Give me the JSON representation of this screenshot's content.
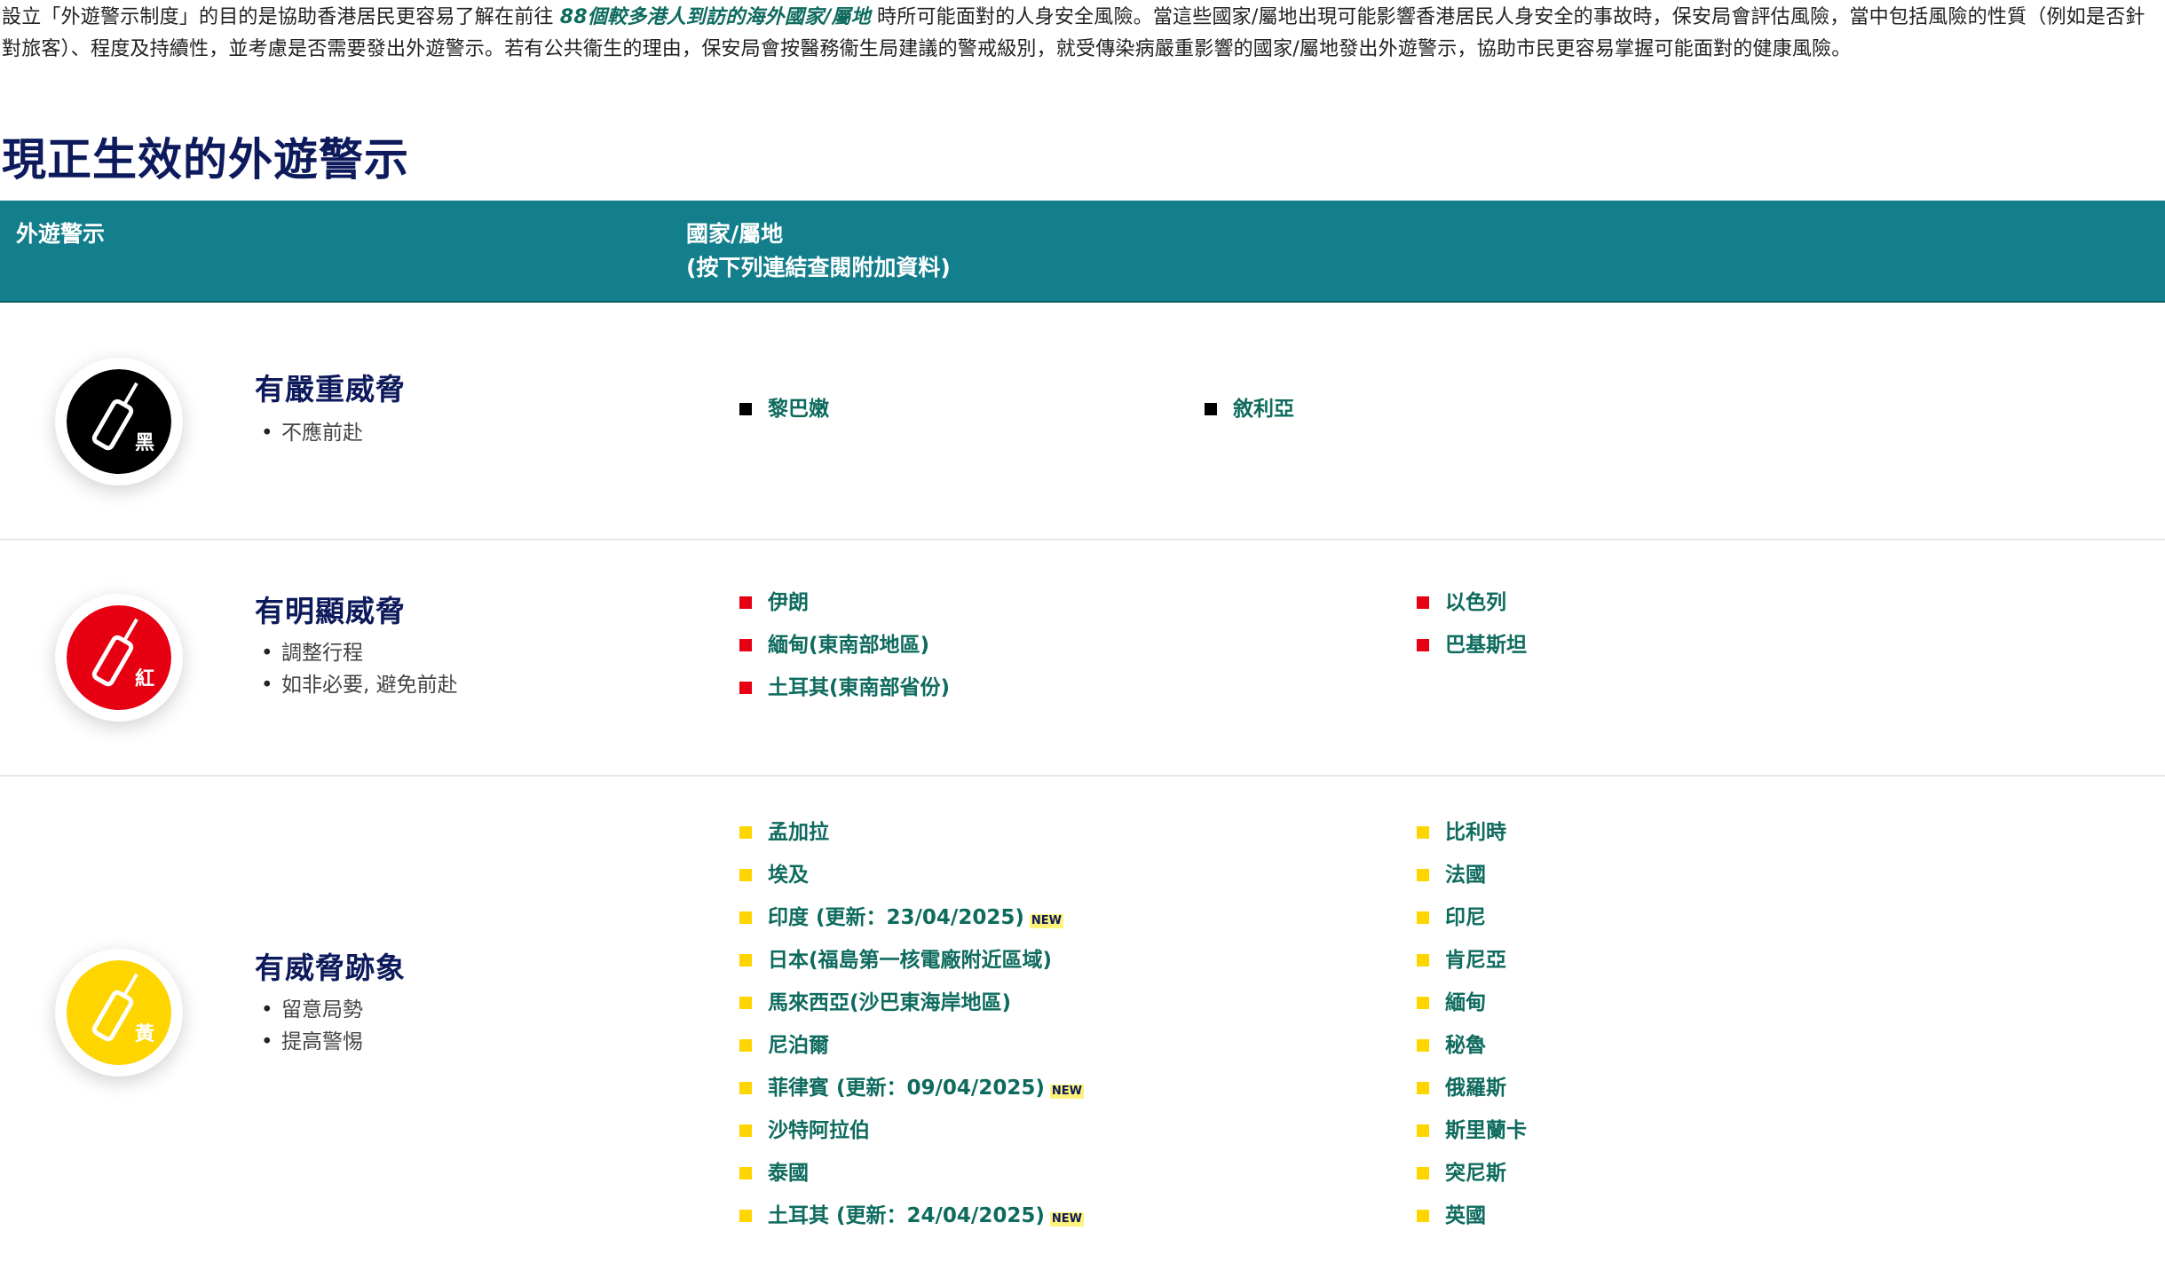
{
  "intro": {
    "part1": "設立「外遊警示制度」的目的是協助香港居民更容易了解在前往 ",
    "link": "88個較多港人到訪的海外國家/屬地",
    "part2": " 時所可能面對的人身安全風險。當這些國家/屬地出現可能影響香港居民人身安全的事故時，保安局會評估風險，當中包括風險的性質（例如是否針對旅客）、程度及持續性，並考慮是否需要發出外遊警示。若有公共衞生的理由，保安局會按醫務衞生局建議的警戒級別，就受傳染病嚴重影響的國家/屬地發出外遊警示，協助市民更容易掌握可能面對的健康風險。"
  },
  "page_title": "現正生效的外遊警示",
  "table_header": {
    "col1": "外遊警示",
    "col2_line1": "國家/屬地",
    "col2_line2": "(按下列連結查閱附加資料)"
  },
  "colors": {
    "header_bg": "#137f8c",
    "title": "#0d1a5c",
    "link": "#0e6b5e",
    "black": "#000000",
    "red": "#e60012",
    "yellow": "#ffd500",
    "new_bg": "#fff27a"
  },
  "levels": {
    "black": {
      "badge_icon": "luggage-icon",
      "badge_char": "黑",
      "title": "有嚴重威脅",
      "notes": [
        "不應前赴"
      ],
      "countries_col1": [
        {
          "name": "黎巴嫩",
          "new": ""
        }
      ],
      "countries_col2": [
        {
          "name": "敘利亞",
          "new": ""
        }
      ]
    },
    "red": {
      "badge_icon": "luggage-icon",
      "badge_char": "紅",
      "title": "有明顯威脅",
      "notes": [
        "調整行程",
        "如非必要, 避免前赴"
      ],
      "countries_col1": [
        {
          "name": "伊朗",
          "new": ""
        },
        {
          "name": "緬甸(東南部地區)",
          "new": ""
        },
        {
          "name": "土耳其(東南部省份)",
          "new": ""
        }
      ],
      "countries_col2": [
        {
          "name": "以色列",
          "new": ""
        },
        {
          "name": "巴基斯坦",
          "new": ""
        }
      ]
    },
    "yellow": {
      "badge_icon": "luggage-icon",
      "badge_char": "黃",
      "title": "有威脅跡象",
      "notes": [
        "留意局勢",
        "提高警惕"
      ],
      "countries_col1": [
        {
          "name": "孟加拉",
          "new": ""
        },
        {
          "name": "埃及",
          "new": ""
        },
        {
          "name": "印度 (更新：23/04/2025)",
          "new": "NEW"
        },
        {
          "name": "日本(福島第一核電廠附近區域)",
          "new": ""
        },
        {
          "name": "馬來西亞(沙巴東海岸地區)",
          "new": ""
        },
        {
          "name": "尼泊爾",
          "new": ""
        },
        {
          "name": "菲律賓 (更新：09/04/2025)",
          "new": "NEW"
        },
        {
          "name": "沙特阿拉伯",
          "new": ""
        },
        {
          "name": "泰國",
          "new": ""
        },
        {
          "name": "土耳其 (更新：24/04/2025)",
          "new": "NEW"
        }
      ],
      "countries_col2": [
        {
          "name": "比利時",
          "new": ""
        },
        {
          "name": "法國",
          "new": ""
        },
        {
          "name": "印尼",
          "new": ""
        },
        {
          "name": "肯尼亞",
          "new": ""
        },
        {
          "name": "緬甸",
          "new": ""
        },
        {
          "name": "秘魯",
          "new": ""
        },
        {
          "name": "俄羅斯",
          "new": ""
        },
        {
          "name": "斯里蘭卡",
          "new": ""
        },
        {
          "name": "突尼斯",
          "new": ""
        },
        {
          "name": "英國",
          "new": ""
        }
      ]
    }
  }
}
